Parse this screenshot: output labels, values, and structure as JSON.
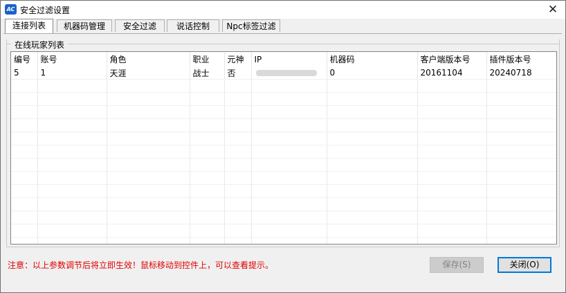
{
  "window": {
    "title": "安全过滤设置",
    "icon_text": "AC",
    "close_glyph": "✕"
  },
  "tabs": [
    {
      "label": "连接列表",
      "active": true
    },
    {
      "label": "机器码管理",
      "active": false
    },
    {
      "label": "安全过滤",
      "active": false
    },
    {
      "label": "说话控制",
      "active": false
    },
    {
      "label": "Npc标签过滤",
      "active": false
    }
  ],
  "group": {
    "label": "在线玩家列表"
  },
  "table": {
    "columns": [
      "编号",
      "账号",
      "角色",
      "职业",
      "元神",
      "IP",
      "机器码",
      "客户端版本号",
      "插件版本号"
    ],
    "rows": [
      [
        "5",
        "1",
        "天涯",
        "战士",
        "否",
        "",
        "0",
        "20161104",
        "20240718"
      ]
    ],
    "empty_rows": 13
  },
  "footer": {
    "notice": "注意：以上参数调节后将立即生效！鼠标移动到控件上，可以查看提示。",
    "save_label": "保存(S)",
    "close_label": "关闭(O)"
  },
  "colors": {
    "accent": "#0078d7",
    "notice": "#e00000"
  }
}
